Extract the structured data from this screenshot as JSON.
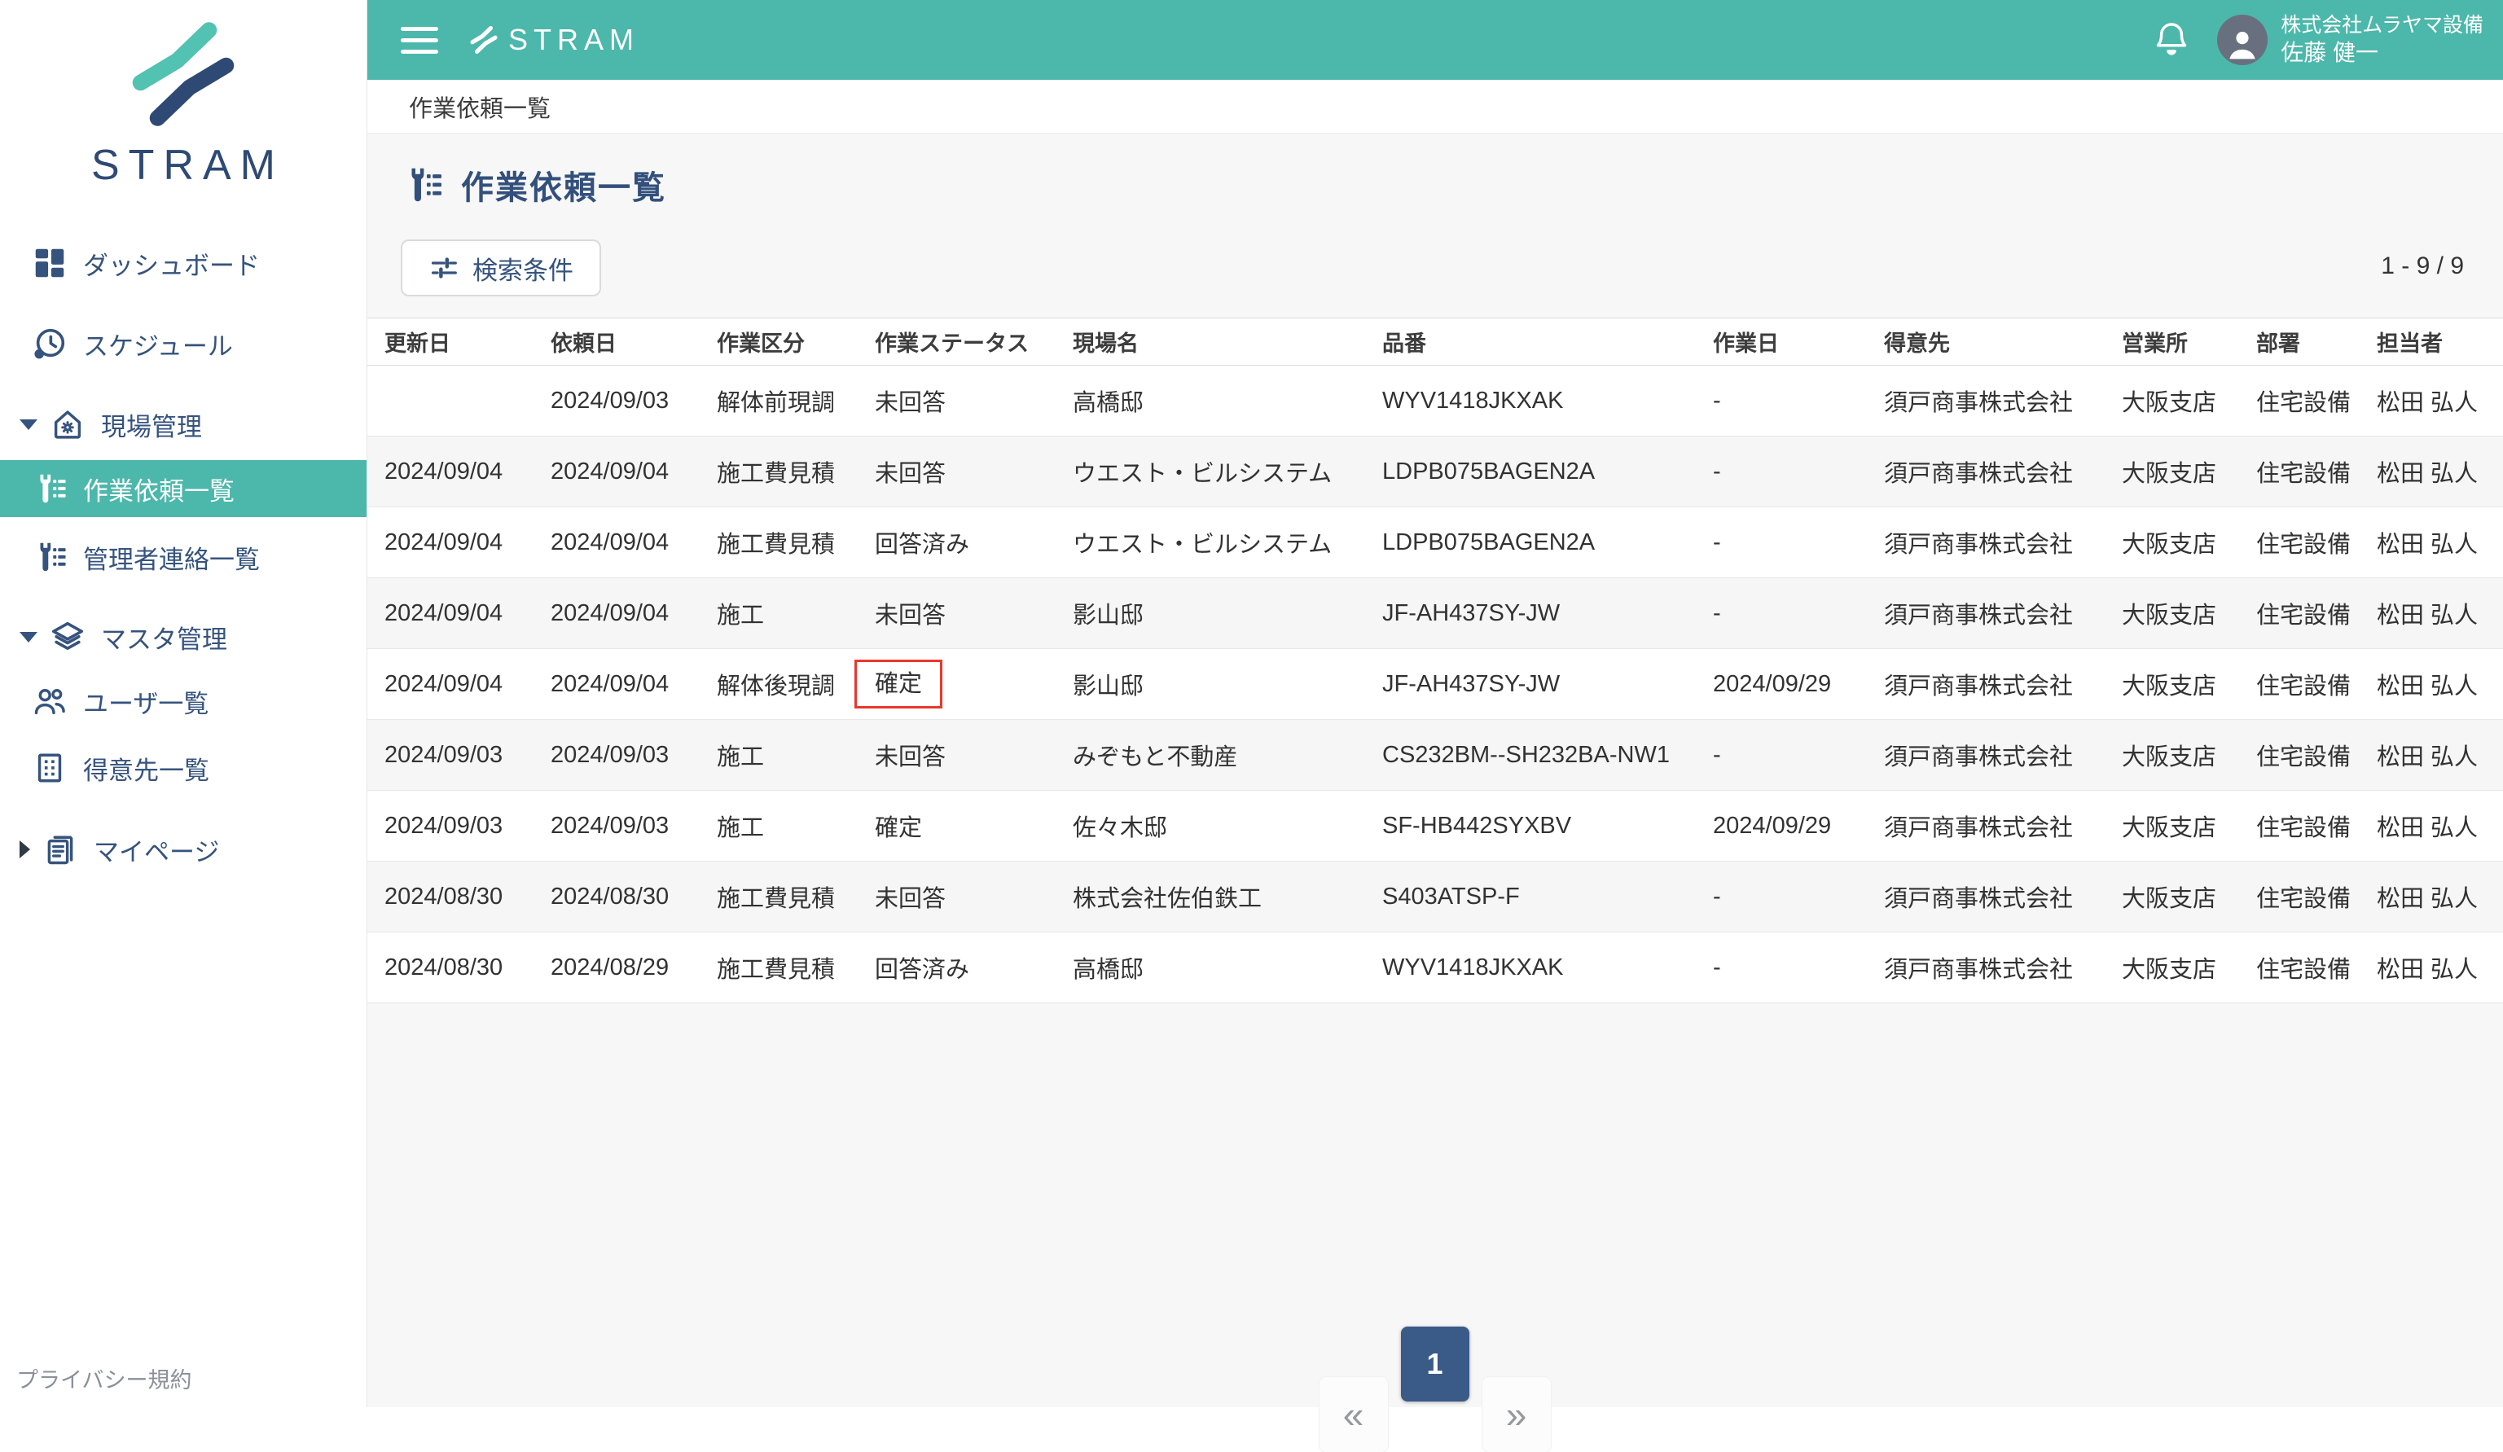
{
  "brand": {
    "wordmark": "STRAM"
  },
  "topbar": {
    "company": "株式会社ムラヤマ設備",
    "user_name": "佐藤 健一"
  },
  "breadcrumb": {
    "current": "作業依頼一覧"
  },
  "sidebar": {
    "privacy": "プライバシー規約",
    "items": [
      {
        "id": "dashboard",
        "label": "ダッシュボード",
        "icon": "dashboard-icon",
        "type": "top"
      },
      {
        "id": "schedule",
        "label": "スケジュール",
        "icon": "clock-icon",
        "type": "top"
      },
      {
        "id": "site-management",
        "label": "現場管理",
        "icon": "house-gear-icon",
        "type": "group",
        "expanded": true
      },
      {
        "id": "work-requests",
        "label": "作業依頼一覧",
        "icon": "wrench-list-icon",
        "type": "sub",
        "active": true
      },
      {
        "id": "admin-contacts",
        "label": "管理者連絡一覧",
        "icon": "wrench-list-icon",
        "type": "sub"
      },
      {
        "id": "master-management",
        "label": "マスタ管理",
        "icon": "layers-icon",
        "type": "group",
        "expanded": true
      },
      {
        "id": "users",
        "label": "ユーザ一覧",
        "icon": "users-icon",
        "type": "sub"
      },
      {
        "id": "clients",
        "label": "得意先一覧",
        "icon": "building-icon",
        "type": "sub"
      },
      {
        "id": "mypage",
        "label": "マイページ",
        "icon": "document-icon",
        "type": "group",
        "expanded": false
      }
    ]
  },
  "page": {
    "title": "作業依頼一覧",
    "search_button": "検索条件",
    "range_counter": "1 - 9 / 9"
  },
  "table": {
    "columns": [
      "更新日",
      "依頼日",
      "作業区分",
      "作業ステータス",
      "現場名",
      "品番",
      "作業日",
      "得意先",
      "営業所",
      "部署",
      "担当者"
    ],
    "rows": [
      [
        "",
        "2024/09/03",
        "解体前現調",
        "未回答",
        "高橋邸",
        "WYV1418JKXAK",
        "-",
        "須戸商事株式会社",
        "大阪支店",
        "住宅設備",
        "松田 弘人"
      ],
      [
        "2024/09/04",
        "2024/09/04",
        "施工費見積",
        "未回答",
        "ウエスト・ビルシステム",
        "LDPB075BAGEN2A",
        "-",
        "須戸商事株式会社",
        "大阪支店",
        "住宅設備",
        "松田 弘人"
      ],
      [
        "2024/09/04",
        "2024/09/04",
        "施工費見積",
        "回答済み",
        "ウエスト・ビルシステム",
        "LDPB075BAGEN2A",
        "-",
        "須戸商事株式会社",
        "大阪支店",
        "住宅設備",
        "松田 弘人"
      ],
      [
        "2024/09/04",
        "2024/09/04",
        "施工",
        "未回答",
        "影山邸",
        "JF-AH437SY-JW",
        "-",
        "須戸商事株式会社",
        "大阪支店",
        "住宅設備",
        "松田 弘人"
      ],
      [
        "2024/09/04",
        "2024/09/04",
        "解体後現調",
        "確定",
        "影山邸",
        "JF-AH437SY-JW",
        "2024/09/29",
        "須戸商事株式会社",
        "大阪支店",
        "住宅設備",
        "松田 弘人"
      ],
      [
        "2024/09/03",
        "2024/09/03",
        "施工",
        "未回答",
        "みぞもと不動産",
        "CS232BM--SH232BA-NW1",
        "-",
        "須戸商事株式会社",
        "大阪支店",
        "住宅設備",
        "松田 弘人"
      ],
      [
        "2024/09/03",
        "2024/09/03",
        "施工",
        "確定",
        "佐々木邸",
        "SF-HB442SYXBV",
        "2024/09/29",
        "須戸商事株式会社",
        "大阪支店",
        "住宅設備",
        "松田 弘人"
      ],
      [
        "2024/08/30",
        "2024/08/30",
        "施工費見積",
        "未回答",
        "株式会社佐伯鉄工",
        "S403ATSP-F",
        "-",
        "須戸商事株式会社",
        "大阪支店",
        "住宅設備",
        "松田 弘人"
      ],
      [
        "2024/08/30",
        "2024/08/29",
        "施工費見積",
        "回答済み",
        "高橋邸",
        "WYV1418JKXAK",
        "-",
        "須戸商事株式会社",
        "大阪支店",
        "住宅設備",
        "松田 弘人"
      ]
    ],
    "highlight_cell": {
      "row_index": 4,
      "col_index": 3
    }
  },
  "pagination": {
    "first_label": "«",
    "active_page": "1",
    "last_label": "»"
  },
  "colors": {
    "teal": "#4cb7ab",
    "navy": "#35537d",
    "logo_navy": "#2e4a74",
    "pagination_active": "#3a5a88",
    "highlight_red": "#e8382e"
  }
}
